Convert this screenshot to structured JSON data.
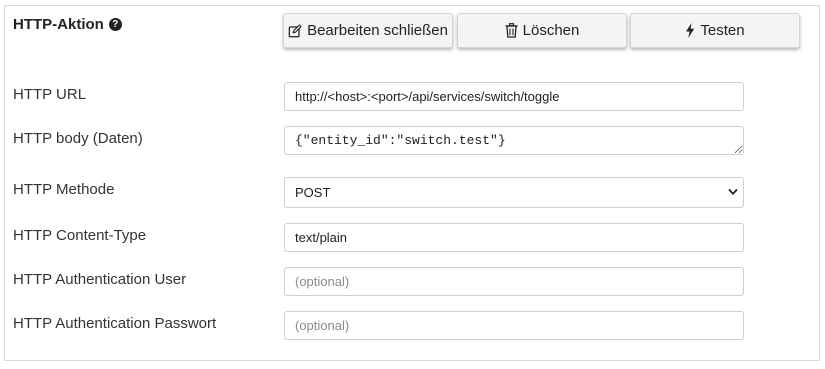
{
  "panel": {
    "title": "HTTP-Aktion",
    "help_icon": "question-circle-icon",
    "help_glyph": "?"
  },
  "toolbar": {
    "edit_close_label": "Bearbeiten schließen",
    "edit_close_icon": "edit-icon",
    "delete_label": "Löschen",
    "delete_icon": "trash-icon",
    "test_label": "Testen",
    "test_icon": "bolt-icon"
  },
  "form": {
    "url_label": "HTTP URL",
    "url_value": "http://<host>:<port>/api/services/switch/toggle",
    "body_label": "HTTP body (Daten)",
    "body_value": "{\"entity_id\":\"switch.test\"}",
    "method_label": "HTTP Methode",
    "method_value": "POST",
    "content_type_label": "HTTP Content-Type",
    "content_type_value": "text/plain",
    "auth_user_label": "HTTP Authentication User",
    "auth_user_value": "",
    "auth_user_placeholder": "(optional)",
    "auth_password_label": "HTTP Authentication Passwort",
    "auth_password_value": "",
    "auth_password_placeholder": "(optional)"
  }
}
